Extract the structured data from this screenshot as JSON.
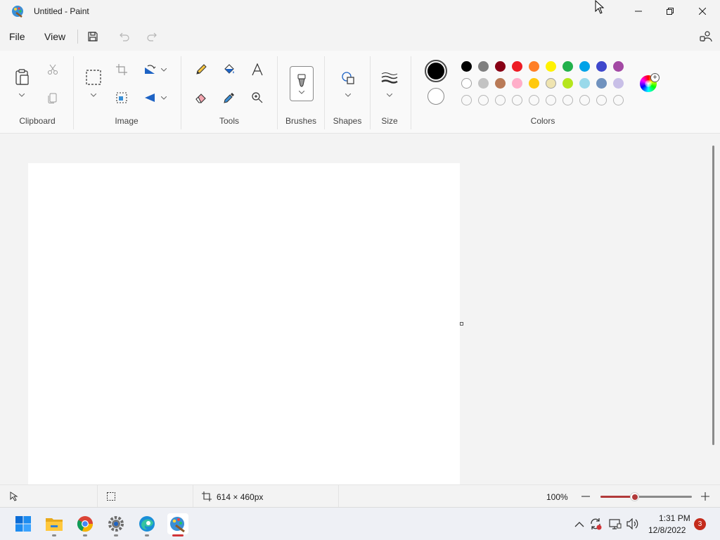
{
  "window": {
    "title": "Untitled - Paint",
    "app_icon": "paint-palette-icon"
  },
  "menu": {
    "file": "File",
    "view": "View"
  },
  "ribbon": {
    "groups": {
      "clipboard": "Clipboard",
      "image": "Image",
      "tools": "Tools",
      "brushes": "Brushes",
      "shapes": "Shapes",
      "size": "Size",
      "colors": "Colors"
    }
  },
  "colors": {
    "primary": "#000000",
    "secondary": "#ffffff",
    "palette_row1": [
      "#000000",
      "#7f7f7f",
      "#880015",
      "#ed1c24",
      "#ff7f27",
      "#fff200",
      "#22b14c",
      "#00a2e8",
      "#3f48cc",
      "#a349a4"
    ],
    "palette_row2": [
      "#ffffff",
      "#c3c3c3",
      "#b97a57",
      "#ffaec9",
      "#ffc90e",
      "#efe4b0",
      "#b5e61d",
      "#99d9ea",
      "#7092be",
      "#c8bfe7"
    ],
    "palette_row3_empty_count": 10,
    "accent": "#b23a3a"
  },
  "status": {
    "canvas_size": "614 × 460px",
    "zoom": "100%",
    "zoom_fraction": 0.38
  },
  "taskbar": {
    "apps": [
      "start-icon",
      "file-explorer-icon",
      "chrome-icon",
      "settings-icon",
      "edge-icon",
      "paint-icon"
    ],
    "time": "1:31 PM",
    "date": "12/8/2022",
    "notifications": "3"
  }
}
